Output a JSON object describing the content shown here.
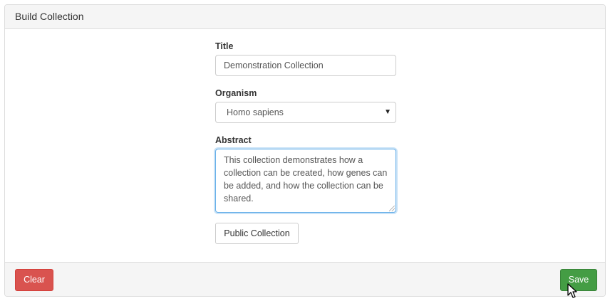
{
  "panel": {
    "title": "Build Collection"
  },
  "form": {
    "title_label": "Title",
    "title_value": "Demonstration Collection",
    "organism_label": "Organism",
    "organism_selected": "Homo sapiens",
    "abstract_label": "Abstract",
    "abstract_value": "This collection demonstrates how a collection can be created, how genes can be added, and how the collection can be shared.",
    "public_button_label": "Public Collection"
  },
  "footer": {
    "clear_label": "Clear",
    "save_label": "Save"
  },
  "colors": {
    "clear": "#d9534f",
    "save": "#449d44",
    "focus_border": "#66afe9",
    "panel_bg": "#f5f5f5"
  },
  "icons": {
    "select_caret": "caret-down-icon",
    "cursor": "mouse-pointer-icon"
  }
}
